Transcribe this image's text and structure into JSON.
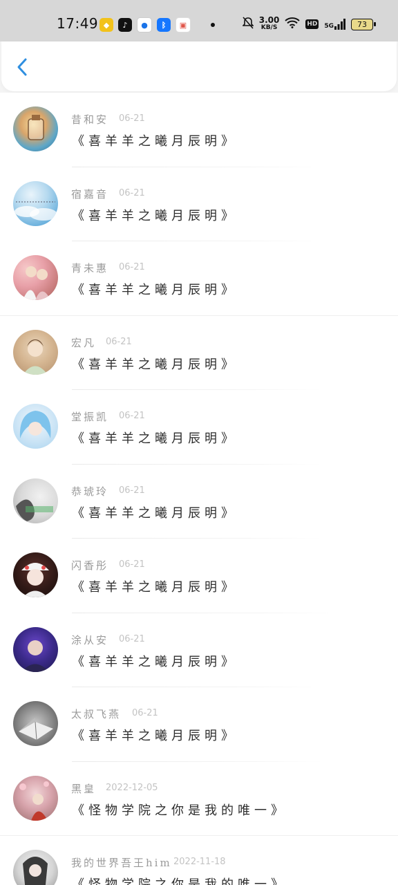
{
  "status_bar": {
    "time": "17:49",
    "net_speed_value": "3.00",
    "net_speed_unit": "KB/S",
    "hd_label": "HD",
    "signal_label": "5G",
    "battery": "73"
  },
  "header": {
    "back_icon": "chevron-left-icon"
  },
  "items": [
    {
      "name": "昔和安",
      "date": "06-21",
      "title": "《喜羊羊之曦月辰明》"
    },
    {
      "name": "宿嘉音",
      "date": "06-21",
      "title": "《喜羊羊之曦月辰明》"
    },
    {
      "name": "青未惠",
      "date": "06-21",
      "title": "《喜羊羊之曦月辰明》"
    },
    {
      "name": "宏凡",
      "date": "06-21",
      "title": "《喜羊羊之曦月辰明》"
    },
    {
      "name": "堂振凯",
      "date": "06-21",
      "title": "《喜羊羊之曦月辰明》"
    },
    {
      "name": "恭琥玲",
      "date": "06-21",
      "title": "《喜羊羊之曦月辰明》"
    },
    {
      "name": "闪香彤",
      "date": "06-21",
      "title": "《喜羊羊之曦月辰明》"
    },
    {
      "name": "涂从安",
      "date": "06-21",
      "title": "《喜羊羊之曦月辰明》"
    },
    {
      "name": "太叔飞燕",
      "date": "06-21",
      "title": "《喜羊羊之曦月辰明》"
    },
    {
      "name": "黑皇",
      "date": "2022-12-05",
      "title": "《怪物学院之你是我的唯一》"
    },
    {
      "name": "我的世界吾王him",
      "date": "2022-11-18",
      "title": "《怪物学院之你是我的唯一》"
    }
  ],
  "colors": {
    "accent": "#2f8fe0",
    "name_text": "#9a9a9a",
    "date_text": "#c3c3c3",
    "title_text": "#2d2d2d"
  }
}
